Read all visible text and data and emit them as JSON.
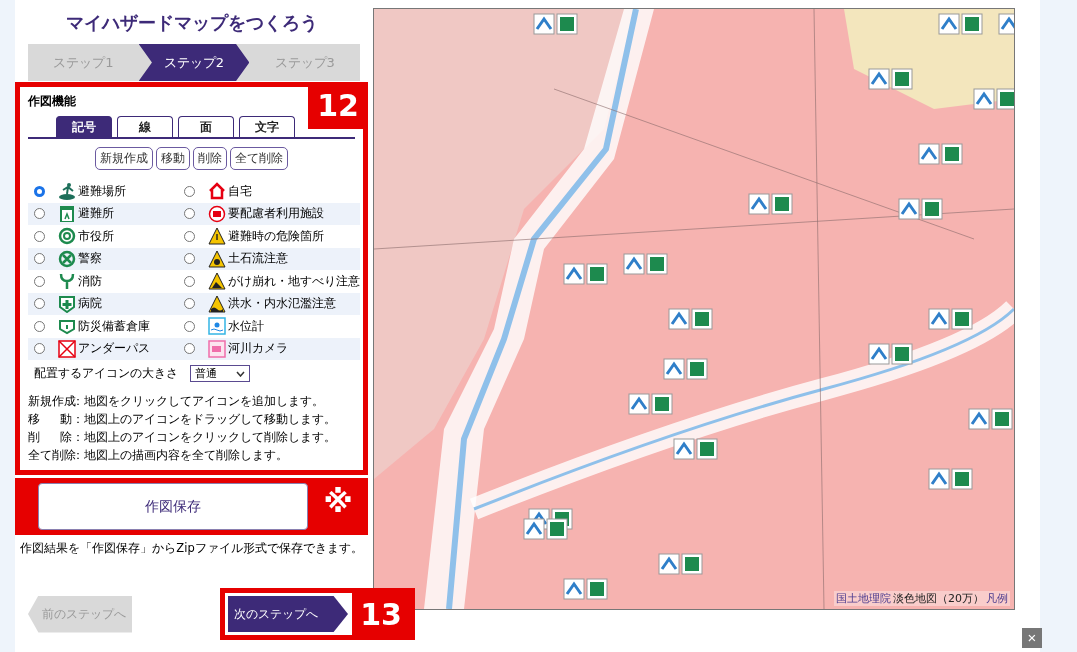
{
  "title": "マイハザードマップをつくろう",
  "steps": [
    {
      "label": "ステップ1",
      "selected": false
    },
    {
      "label": "ステップ2",
      "selected": true
    },
    {
      "label": "ステップ3",
      "selected": false
    }
  ],
  "drawing_panel": {
    "heading": "作図機能",
    "callout": "12",
    "tabs": [
      {
        "label": "記号",
        "selected": true
      },
      {
        "label": "線",
        "selected": false
      },
      {
        "label": "面",
        "selected": false
      },
      {
        "label": "文字",
        "selected": false
      }
    ],
    "actions": [
      "新規作成",
      "移動",
      "削除",
      "全て削除"
    ],
    "symbols": [
      {
        "label": "避難場所",
        "selected": true
      },
      {
        "label": "自宅",
        "selected": false
      },
      {
        "label": "避難所",
        "selected": false
      },
      {
        "label": "要配慮者利用施設",
        "selected": false
      },
      {
        "label": "市役所",
        "selected": false
      },
      {
        "label": "避難時の危険箇所",
        "selected": false
      },
      {
        "label": "警察",
        "selected": false
      },
      {
        "label": "土石流注意",
        "selected": false
      },
      {
        "label": "消防",
        "selected": false
      },
      {
        "label": "がけ崩れ・地すべり注意",
        "selected": false
      },
      {
        "label": "病院",
        "selected": false
      },
      {
        "label": "洪水・内水氾濫注意",
        "selected": false
      },
      {
        "label": "防災備蓄倉庫",
        "selected": false
      },
      {
        "label": "水位計",
        "selected": false
      },
      {
        "label": "アンダーパス",
        "selected": false
      },
      {
        "label": "河川カメラ",
        "selected": false
      }
    ],
    "icon_size": {
      "label": "配置するアイコンの大きさ",
      "value": "普通"
    },
    "help": [
      {
        "label": "新規作成",
        "text": "：地図をクリックしてアイコンを追加します。"
      },
      {
        "label": "移動",
        "text": "：地図上のアイコンをドラッグして移動します。"
      },
      {
        "label": "削除",
        "text": "：地図上のアイコンをクリックして削除します。"
      },
      {
        "label": "全て削除",
        "text": "：地図上の描画内容を全て削除します。"
      }
    ]
  },
  "save": {
    "button": "作図保存",
    "callout": "※",
    "note": "作図結果を「作図保存」からZipファイル形式で保存できます。"
  },
  "nav": {
    "prev": "前のステップへ",
    "next": "次のステップへ",
    "callout": "13"
  },
  "map": {
    "attribution": [
      {
        "text": "国土地理院",
        "link": true
      },
      {
        "text": "淡色地図（20万）",
        "link": false
      },
      {
        "text": "凡例",
        "link": true
      }
    ]
  },
  "close": "×"
}
